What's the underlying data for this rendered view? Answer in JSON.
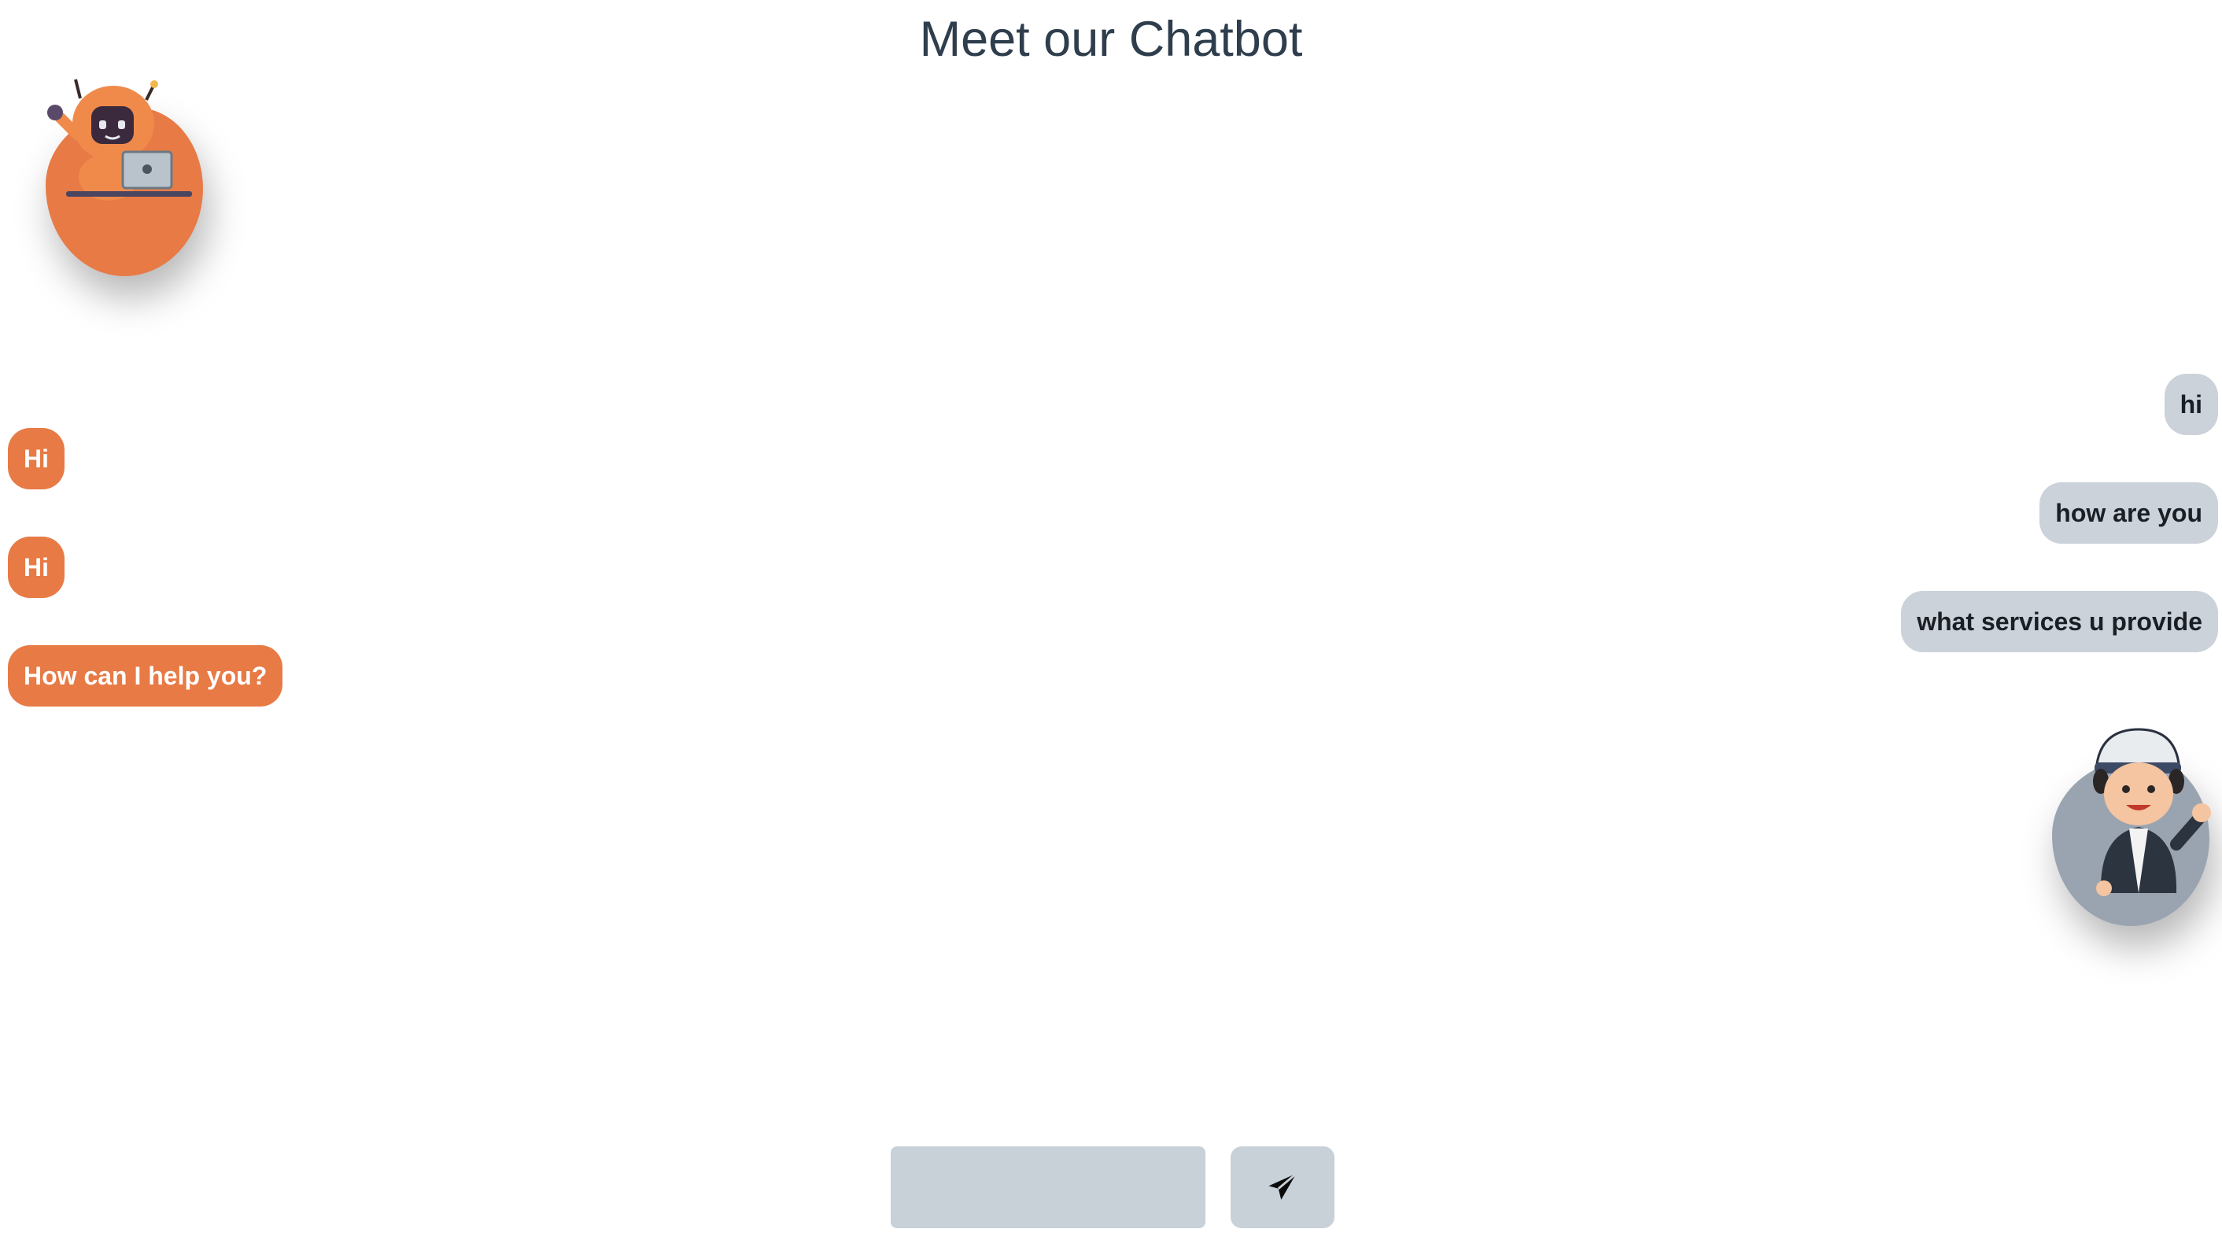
{
  "page": {
    "title": "Meet our Chatbot"
  },
  "colors": {
    "bot_bubble": "#e87a45",
    "user_bubble": "#cbd2d9",
    "title_text": "#2f3e4d",
    "input_bg": "#c8d0d8"
  },
  "avatars": {
    "bot": "robot-with-laptop-icon",
    "user": "waving-boy-icon"
  },
  "messages": [
    {
      "sender": "user",
      "text": "hi"
    },
    {
      "sender": "bot",
      "text": "Hi"
    },
    {
      "sender": "user",
      "text": "how are you"
    },
    {
      "sender": "bot",
      "text": "Hi"
    },
    {
      "sender": "user",
      "text": "what services u provide"
    },
    {
      "sender": "bot",
      "text": "How can I help you?"
    }
  ],
  "composer": {
    "input_value": "",
    "send_icon": "paper-plane-icon"
  }
}
